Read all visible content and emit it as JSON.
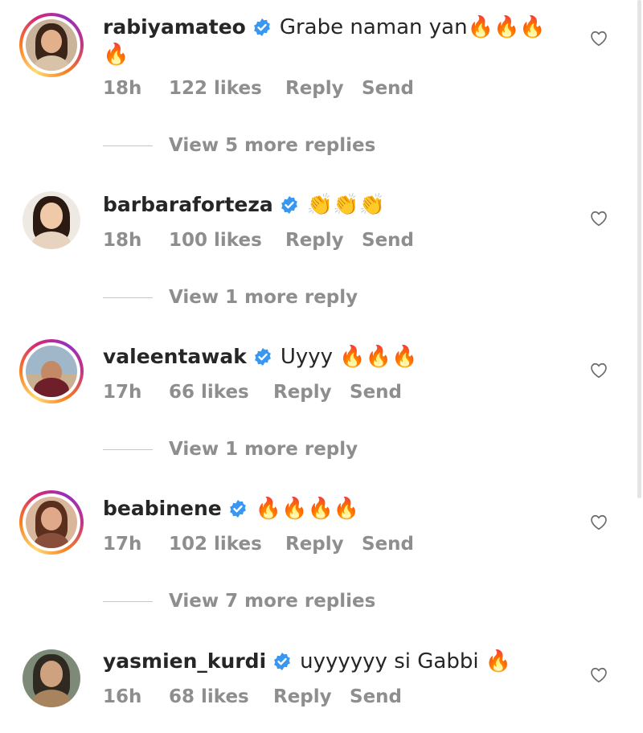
{
  "comments": [
    {
      "username": "rabiyamateo",
      "text_line1": "Grabe naman yan🔥🔥🔥",
      "text_line2": "🔥",
      "time": "18h",
      "likes": "122 likes",
      "reply": "Reply",
      "send": "Send",
      "view_replies": "View 5 more replies"
    },
    {
      "username": "barbaraforteza",
      "text_line1": "👏👏👏",
      "time": "18h",
      "likes": "100 likes",
      "reply": "Reply",
      "send": "Send",
      "view_replies": "View 1 more reply"
    },
    {
      "username": "valeentawak",
      "text_line1": "Uyyy 🔥🔥🔥",
      "time": "17h",
      "likes": "66 likes",
      "reply": "Reply",
      "send": "Send",
      "view_replies": "View 1 more reply"
    },
    {
      "username": "beabinene",
      "text_line1": "🔥🔥🔥🔥",
      "time": "17h",
      "likes": "102 likes",
      "reply": "Reply",
      "send": "Send",
      "view_replies": "View 7 more replies"
    },
    {
      "username": "yasmien_kurdi",
      "text_line1": "uyyyyyy si Gabbi 🔥",
      "time": "16h",
      "likes": "68 likes",
      "reply": "Reply",
      "send": "Send"
    }
  ],
  "colors": {
    "verified": "#3897f0",
    "muted": "#8e8e8e",
    "text": "#262626"
  },
  "icons": {
    "verified": "verified-badge-icon",
    "heart": "heart-outline-icon"
  }
}
